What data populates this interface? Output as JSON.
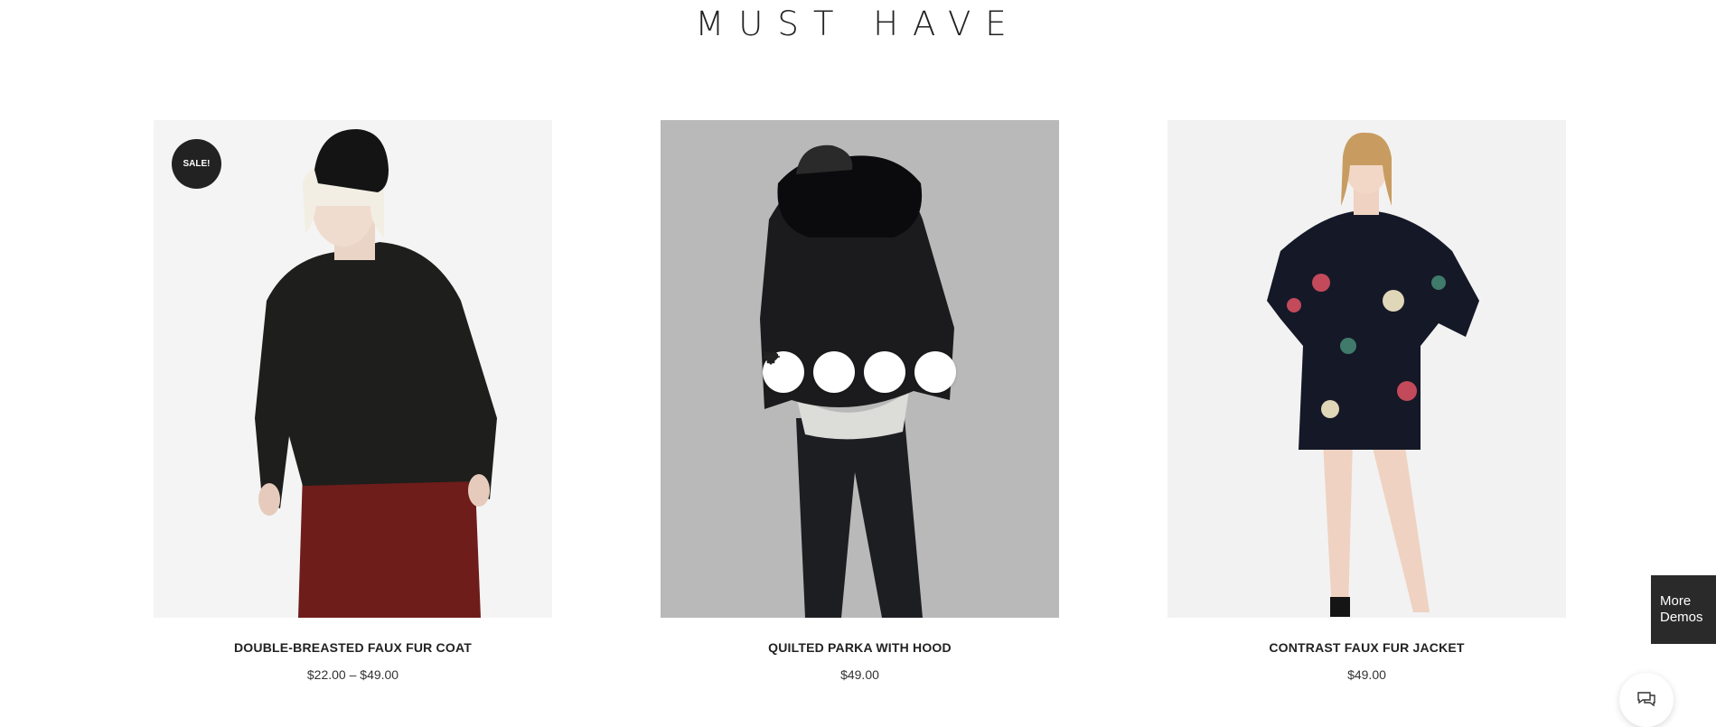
{
  "section": {
    "title": "MUST HAVE"
  },
  "products": [
    {
      "name": "DOUBLE-BREASTED FAUX FUR COAT",
      "price": "$22.00 – $49.00",
      "badge": "SALE!"
    },
    {
      "name": "QUILTED PARKA WITH HOOD",
      "price": "$49.00"
    },
    {
      "name": "CONTRAST FAUX FUR JACKET",
      "price": "$49.00"
    }
  ],
  "hover_actions": [
    "eye-icon",
    "heart-icon",
    "compare-icon",
    "cart-icon"
  ],
  "more_demos": {
    "label": "More Demos"
  },
  "chat": {
    "icon": "chat-icon"
  },
  "colors": {
    "dark": "#222222",
    "badge": "#222222",
    "sidebar_button": "#2a2a2a"
  }
}
